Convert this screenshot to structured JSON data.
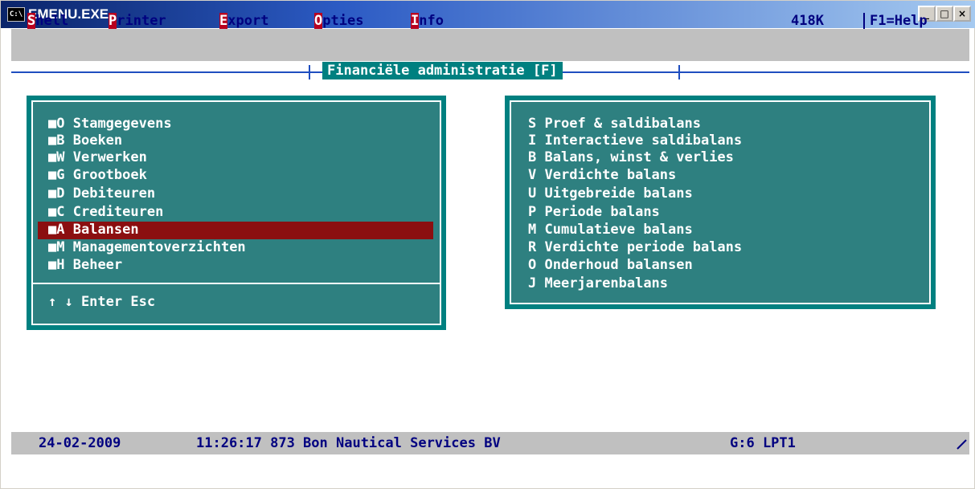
{
  "window": {
    "title": "EMENU.EXE",
    "icon_label": "C:\\",
    "buttons": [
      "_",
      "□",
      "×"
    ]
  },
  "menubar": {
    "items": [
      {
        "hot": "S",
        "rest": "hell"
      },
      {
        "hot": "P",
        "rest": "rinter"
      },
      {
        "hot": "E",
        "rest": "xport"
      },
      {
        "hot": "O",
        "rest": "pties"
      },
      {
        "hot": "I",
        "rest": "nfo"
      }
    ],
    "memory": "418K",
    "help": "F1=Help"
  },
  "header": {
    "title": "Financiële administratie [F]"
  },
  "left_menu": {
    "items": [
      {
        "key": "■O",
        "label": "Stamgegevens"
      },
      {
        "key": "■B",
        "label": "Boeken"
      },
      {
        "key": "■W",
        "label": "Verwerken"
      },
      {
        "key": "■G",
        "label": "Grootboek"
      },
      {
        "key": "■D",
        "label": "Debiteuren"
      },
      {
        "key": "■C",
        "label": "Crediteuren"
      },
      {
        "key": "■A",
        "label": "Balansen"
      },
      {
        "key": "■M",
        "label": "Managementoverzichten"
      },
      {
        "key": "■H",
        "label": "Beheer"
      }
    ],
    "selected_index": 6,
    "footer": "↑ ↓ Enter Esc"
  },
  "right_menu": {
    "items": [
      {
        "key": "S",
        "label": "Proef & saldibalans"
      },
      {
        "key": "I",
        "label": "Interactieve saldibalans"
      },
      {
        "key": "B",
        "label": "Balans, winst & verlies"
      },
      {
        "key": "V",
        "label": "Verdichte balans"
      },
      {
        "key": "U",
        "label": "Uitgebreide balans"
      },
      {
        "key": "P",
        "label": "Periode balans"
      },
      {
        "key": "M",
        "label": "Cumulatieve balans"
      },
      {
        "key": "R",
        "label": "Verdichte periode balans"
      },
      {
        "key": "O",
        "label": "Onderhoud balansen"
      },
      {
        "key": "J",
        "label": "Meerjarenbalans"
      }
    ]
  },
  "status": {
    "date": "24-02-2009",
    "time_company": "11:26:17 873 Bon Nautical Services BV",
    "printer": "G:6 LPT1"
  },
  "colors": {
    "panel": "#2e8080",
    "selection": "#8b0f10",
    "bar": "#c0c0c0",
    "text_on_bar": "#000080"
  }
}
